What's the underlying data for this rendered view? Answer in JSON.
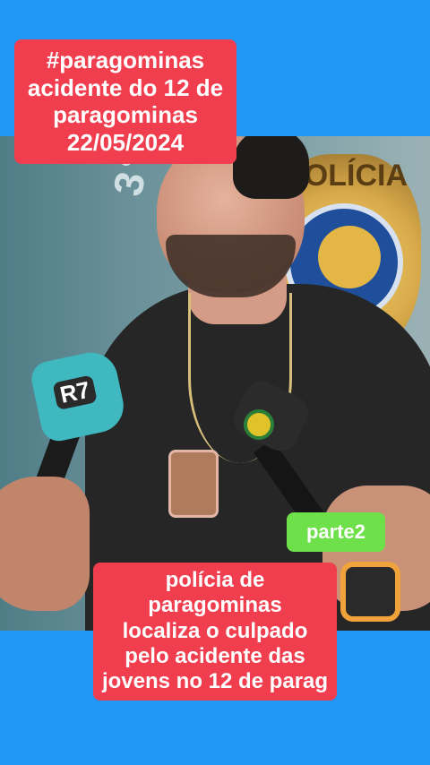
{
  "overlay": {
    "top_caption_lines": [
      "#paragominas",
      "acidente do 12 de",
      "paragominas",
      "22/05/2024"
    ],
    "part_label": "parte2",
    "bottom_caption_lines": [
      "polícia de",
      "paragominas",
      "localiza o culpado",
      "pelo acidente das",
      "jovens no 12 de parag"
    ]
  },
  "scene": {
    "microphone_logo": "R7"
  },
  "colors": {
    "background": "#2196f3",
    "caption_red": "#f03e4e",
    "part_green": "#6ee04a"
  }
}
